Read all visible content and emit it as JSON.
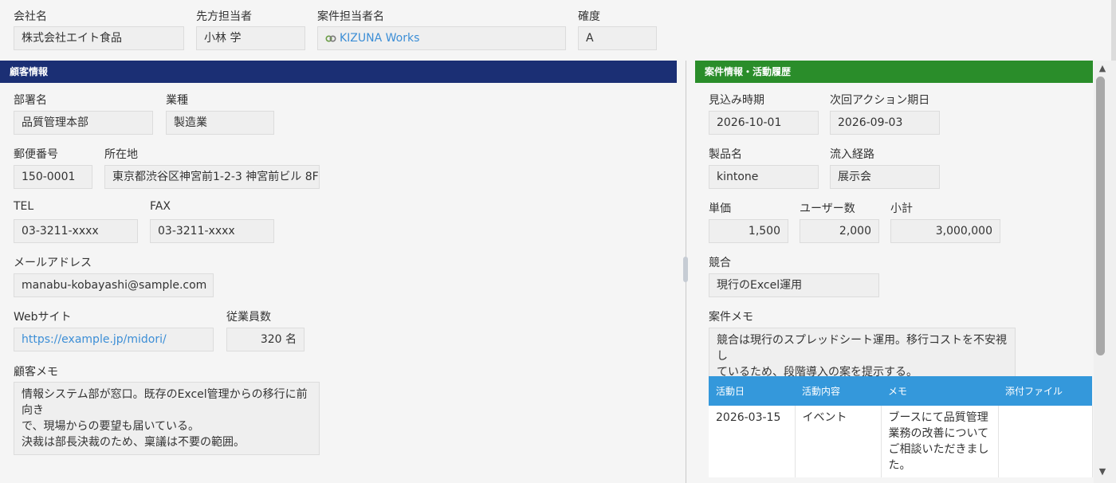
{
  "top": {
    "company_label": "会社名",
    "company_value": "株式会社エイト食品",
    "contact_label": "先方担当者",
    "contact_value": "小林 学",
    "owner_label": "案件担当者名",
    "owner_value": "KIZUNA Works",
    "certainty_label": "確度",
    "certainty_value": "A"
  },
  "customer": {
    "section_title": "顧客情報",
    "dept_label": "部署名",
    "dept_value": "品質管理本部",
    "industry_label": "業種",
    "industry_value": "製造業",
    "zip_label": "郵便番号",
    "zip_value": "150-0001",
    "address_label": "所在地",
    "address_value": "東京都渋谷区神宮前1-2-3 神宮前ビル 8F",
    "tel_label": "TEL",
    "tel_value": "03-3211-xxxx",
    "fax_label": "FAX",
    "fax_value": "03-3211-xxxx",
    "email_label": "メールアドレス",
    "email_value": "manabu-kobayashi@sample.com",
    "web_label": "Webサイト",
    "web_value": "https://example.jp/midori/",
    "employees_label": "従業員数",
    "employees_value": "320 名",
    "memo_label": "顧客メモ",
    "memo_line1": "情報システム部が窓口。既存のExcel管理からの移行に前向き",
    "memo_line2": "で、現場からの要望も届いている。",
    "memo_line3": "決裁は部長決裁のため、稟議は不要の範囲。"
  },
  "deal": {
    "section_title": "案件情報・活動履歴",
    "expected_label": "見込み時期",
    "expected_value": "2026-10-01",
    "next_action_label": "次回アクション期日",
    "next_action_value": "2026-09-03",
    "product_label": "製品名",
    "product_value": "kintone",
    "channel_label": "流入経路",
    "channel_value": "展示会",
    "price_label": "単価",
    "price_value": "1,500",
    "users_label": "ユーザー数",
    "users_value": "2,000",
    "subtotal_label": "小計",
    "subtotal_value": "3,000,000",
    "competitor_label": "競合",
    "competitor_value": "現行のExcel運用",
    "memo_label": "案件メモ",
    "memo_line1": "競合は現行のスプレッドシート運用。移行コストを不安視し",
    "memo_line2": "ているため、段階導入の案を提示する。"
  },
  "activity_table": {
    "headers": [
      "活動日",
      "活動内容",
      "メモ",
      "添付ファイル"
    ],
    "rows": [
      {
        "date": "2026-03-15",
        "type": "イベント",
        "memo_lines": [
          "ブースにて品質管理",
          "業務の改善について",
          "ご相談いただきまし",
          "た。"
        ],
        "attachment": ""
      }
    ]
  },
  "icons": {
    "owner_icon": "kizuna-logo-icon",
    "scroll_up": "arrow-up-icon",
    "scroll_down": "arrow-down-icon"
  },
  "colors": {
    "customer_header": "#1b2f74",
    "deal_header": "#2a8d2a",
    "table_header": "#3498db",
    "link": "#3c8ed6"
  }
}
